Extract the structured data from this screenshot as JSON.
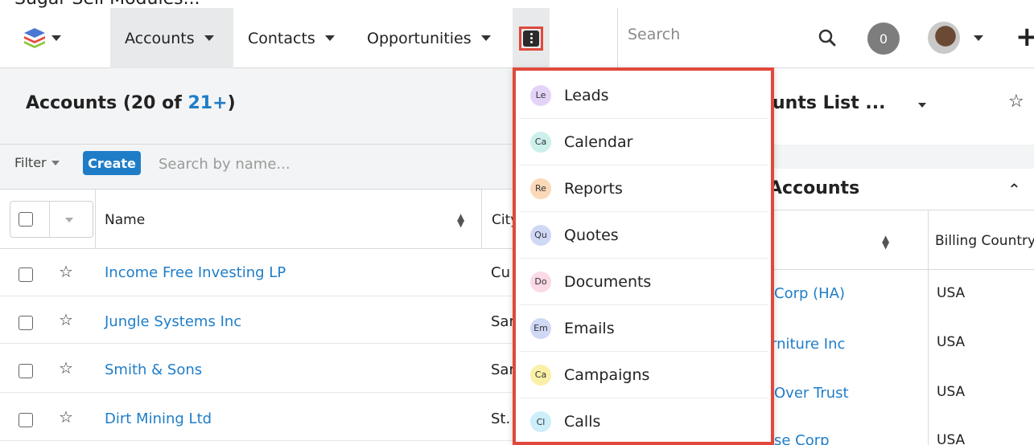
{
  "top_clip_text": "Sugar Sell Modules...",
  "nav": {
    "tabs": [
      {
        "label": "Accounts"
      },
      {
        "label": "Contacts"
      },
      {
        "label": "Opportunities"
      }
    ],
    "search_placeholder": "Search",
    "notification_count": "0"
  },
  "list": {
    "title_prefix": "Accounts (20 of ",
    "title_count": "21+",
    "title_suffix": ")",
    "filter_label": "Filter",
    "create_label": "Create",
    "search_placeholder": "Search by name...",
    "columns": [
      "Name",
      "City"
    ],
    "rows": [
      {
        "name": "Income Free Investing LP",
        "city": "Cu"
      },
      {
        "name": "Jungle Systems Inc",
        "city": "Sar"
      },
      {
        "name": "Smith & Sons",
        "city": "Sar"
      },
      {
        "name": "Dirt Mining Ltd",
        "city": "St."
      }
    ]
  },
  "right": {
    "title": "unts List ...",
    "dashlet_title": "Accounts",
    "column": "Billing Country",
    "rows": [
      {
        "name": "Corp (HA)",
        "country": "USA"
      },
      {
        "name": "rniture Inc",
        "country": "USA"
      },
      {
        "name": "Over Trust",
        "country": "USA"
      },
      {
        "name": "se Corp",
        "country": "USA"
      }
    ]
  },
  "menu": {
    "items": [
      {
        "abbr": "Le",
        "label": "Leads",
        "color": "#e3d4f7"
      },
      {
        "abbr": "Ca",
        "label": "Calendar",
        "color": "#cdf0ec"
      },
      {
        "abbr": "Re",
        "label": "Reports",
        "color": "#fbd9b8"
      },
      {
        "abbr": "Qu",
        "label": "Quotes",
        "color": "#cfd8f5"
      },
      {
        "abbr": "Do",
        "label": "Documents",
        "color": "#fbd9e6"
      },
      {
        "abbr": "Em",
        "label": "Emails",
        "color": "#cfd8f5"
      },
      {
        "abbr": "Ca",
        "label": "Campaigns",
        "color": "#fbf0a8"
      },
      {
        "abbr": "Cl",
        "label": "Calls",
        "color": "#cdeefb"
      }
    ]
  },
  "colors": {
    "accent": "#1f7dc8",
    "highlight": "#e0493b"
  }
}
